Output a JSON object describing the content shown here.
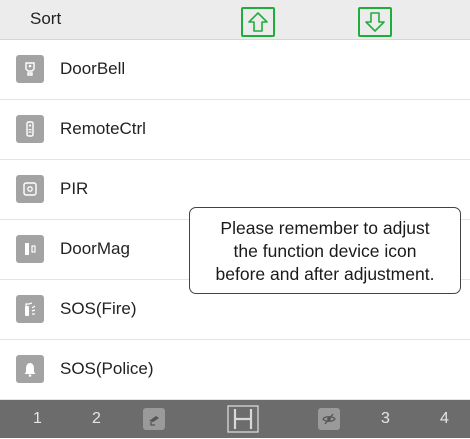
{
  "header": {
    "title": "Sort",
    "up_icon": "arrow-up-icon",
    "down_icon": "arrow-down-icon",
    "accent_color": "#1fae3a"
  },
  "devices": [
    {
      "label": "DoorBell",
      "icon": "doorbell-icon"
    },
    {
      "label": "RemoteCtrl",
      "icon": "remote-control-icon"
    },
    {
      "label": "PIR",
      "icon": "pir-sensor-icon"
    },
    {
      "label": "DoorMag",
      "icon": "door-magnet-icon"
    },
    {
      "label": "SOS(Fire)",
      "icon": "fire-extinguisher-icon"
    },
    {
      "label": "SOS(Police)",
      "icon": "police-bell-icon"
    }
  ],
  "note": {
    "line1": "Please remember to adjust",
    "line2": "the function device icon",
    "line3": "before and after adjustment."
  },
  "bottom_bar": {
    "item1": "1",
    "item2": "2",
    "item3": "3",
    "item4": "4",
    "camera_icon": "camera-icon",
    "home_icon": "home-frame-icon",
    "eye_icon": "eye-hidden-icon"
  }
}
